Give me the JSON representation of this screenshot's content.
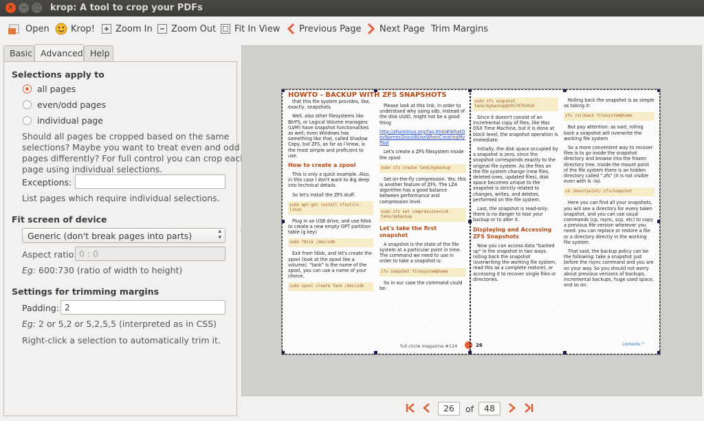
{
  "window": {
    "title": "krop: A tool to crop your PDFs"
  },
  "toolbar": {
    "open": "Open",
    "krop": "Krop!",
    "zoom_in": "Zoom In",
    "zoom_out": "Zoom Out",
    "fit_in_view": "Fit In View",
    "previous_page": "Previous Page",
    "next_page": "Next Page",
    "trim_margins": "Trim Margins"
  },
  "tabs": [
    "Basic",
    "Advanced",
    "Help"
  ],
  "active_tab": "Advanced",
  "advanced": {
    "selections_heading": "Selections apply to",
    "radio_all": "all pages",
    "radio_even_odd": "even/odd pages",
    "radio_individual": "individual page",
    "selected_radio": "all pages",
    "help_line1": "Should all pages be cropped based on the same",
    "help_line2": "selections? Maybe you want to treat even and odd",
    "help_line3": "pages differently? For full control you can crop each",
    "help_line4": "page using individual selections.",
    "exceptions_label": "Exceptions:",
    "exceptions_value": "",
    "exceptions_hint": "List pages which require individual selections.",
    "fit_heading": "Fit screen of device",
    "device_value": "Generic (don't break pages into parts)",
    "aspect_label": "Aspect ratio:",
    "aspect_value": "0 : 0",
    "aspect_eg": "Eg:",
    "aspect_hint": " 600:730 (ratio of width to height)",
    "trim_heading": "Settings for trimming margins",
    "padding_label": "Padding:",
    "padding_value": "2",
    "padding_eg": "Eg:",
    "padding_hint": " 2 or 5,2 or 5,2,5,5 (interpreted as in CSS)",
    "rightclick_hint": "Right-click a selection to automatically trim it."
  },
  "pdf": {
    "title": "HOWTO - BACKUP WITH ZFS SNAPSHOTS",
    "c1p1": "that this file system provides, like, exactly, snapshots.",
    "c1p2": "Well, also other filesystems like BtrFS, or Logical Volume managers (LVM) have snapshot functionalities as well; even Windows has something like that, called Shadow Copy, but ZFS, as far as I know, is the most simple and proficient to use.",
    "c1h": "How to create a zpool",
    "c1p3": "This is only a quick example. Also, in this case I don't want to dig deep into technical details.",
    "c1p4": "So let's install the ZFS stuff.",
    "c1code1": "sudo apt-get install zfsutils-linux",
    "c1p5": "Plug in an USB drive, and use fdisk to create a new empty GPT partition table (g key)",
    "c1code2": "sudo fdisk /dev/sdb",
    "c1p6": "Exit from fdisk, and let's create the zpool (look at the zpool like a volume). \"tank\" is the name of the zpool, you can use a name of your choice.",
    "c1code3": "sudo zpool create tank /dev/sdb",
    "c2p1": "Please look at this link, in order to understand why using sdb, instead of the disk UUID, might not be a good thing",
    "c2link": "http://zfsonlinux.org/faq.html#WhatDevNamesShouldIUseWhenCreatingMyPool",
    "c2p2": "Let's create a ZFS filesystem inside the zpool",
    "c2code1": "sudo zfs create tank/mybackup",
    "c2p3": "Set on-the-fly compression. Yes: this is another feature of ZFS. The LZ4 algorithm has a good balance between performance and compression level.",
    "c2code2": "sudo zfs set compression=lz4 tank/mybackup",
    "c2h": "Let's take the first snapshot",
    "c2p4": "A snapshot is the state of the file system at a particular point in time. The command we need to use in order to take a snapshot is:",
    "c2code3": "zfs snapshot filesystem@name",
    "c2p5": "So in our case the command could be:",
    "c3code1": "sudo zfs snapshot tank/mybackup@20170701010",
    "c3p1": "Since it doesn't consist of an incremental copy of files, like Mac OSX Time Machine, but it is done at block level, the snapshot operation is immediate.",
    "c3p2": "Initially, the disk space occupied by a snapshot is zero, since the snapshot corresponds exactly to the original file system. As the files on the file system change (new files, deleted ones, updated files), disk space becomes unique to the snapshot is strictly related to changes, writes, and deletes, performed on the file system.",
    "c3p3": "Last, the snapshot is read-only: there is no danger to lose your backup or to alter it.",
    "c3h": "Displaying and Accessing ZFS Snapshots",
    "c3p4": "Now you can access data \"backed up\" in the snapshot in two ways: rolling back the snapshot (overwriting the working file system, read this as a complete restore), or accessing it to recover single files or directories.",
    "c4p1": "Rolling back the snapshot is as simple as taking it:",
    "c4code1": "zfs rollback filesystem@name",
    "c4p2": "But pay attention: as said, rolling back a snapshot will overwrite the working file system",
    "c4p3": "So a more convenient way to recover files is to go inside the snapshot directory and browse into the frozen directory tree. Inside the mount point of the file system there is an hidden directory called \".zfs\" (it is not visible even with ls -la).",
    "c4code2": "cd /mountpoint/.zfs/snapshot",
    "c4p4": "Here you can find all your snapshots, you will see a directory for every taken snapshot, and you can use usual commands (cp, rsync, scp, etc) to copy a previous file version wherever you need: you can replace or restore a file or a directory directly in the working file system.",
    "c4p5": "That said, the backup policy can be the following: take a snapshot just before the rsync command and you are on your way. So you should not worry about previous versions of backups, incremental backups, huge used space, and so on.",
    "footer": "full circle magazine #124",
    "footer_page": "26",
    "logo": "contents ^"
  },
  "pager": {
    "current_page": "26",
    "of_label": "of",
    "total_pages": "48"
  }
}
